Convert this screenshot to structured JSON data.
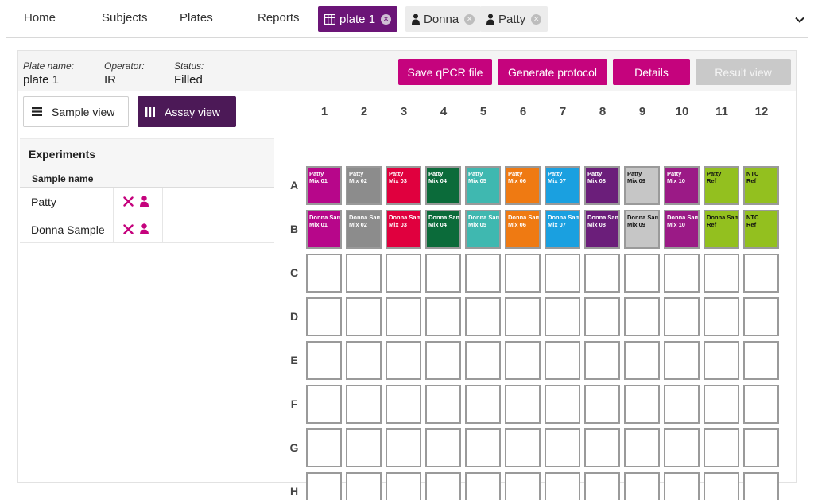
{
  "nav": {
    "links": [
      "Home",
      "Subjects",
      "Plates",
      "Reports"
    ],
    "tabs": [
      {
        "label": "plate 1",
        "icon": "grid-icon",
        "active": true
      },
      {
        "label": "Donna",
        "icon": "person-icon",
        "active": false
      },
      {
        "label": "Patty",
        "icon": "person-icon",
        "active": false
      }
    ],
    "close_glyph": "✕"
  },
  "info": {
    "plate_name_label": "Plate name:",
    "plate_name": "plate 1",
    "operator_label": "Operator:",
    "operator": "IR",
    "status_label": "Status:",
    "status": "Filled"
  },
  "actions": {
    "save_qpcr": "Save qPCR file",
    "generate_protocol": "Generate protocol",
    "details": "Details",
    "result_view": "Result view"
  },
  "views": {
    "sample_view": "Sample view",
    "assay_view": "Assay view"
  },
  "experiments": {
    "title": "Experiments",
    "column_header": "Sample name",
    "rows": [
      {
        "name": "Patty"
      },
      {
        "name": "Donna Sample"
      }
    ]
  },
  "plate": {
    "columns": [
      "1",
      "2",
      "3",
      "4",
      "5",
      "6",
      "7",
      "8",
      "9",
      "10",
      "11",
      "12"
    ],
    "rows": [
      "A",
      "B",
      "C",
      "D",
      "E",
      "F",
      "G",
      "H"
    ],
    "colors": {
      "mix01": "#b7068a",
      "mix02": "#8c8c8c",
      "mix03": "#e0003e",
      "mix04": "#0b6b3a",
      "mix05": "#3fb8b0",
      "mix06": "#ef7a12",
      "mix07": "#1aa0e0",
      "mix08": "#6b1e7a",
      "mix09": "#c6c6c6",
      "mix10": "#9b1a86",
      "ref": "#93c01f"
    },
    "wells": {
      "A": [
        {
          "l1": "Patty",
          "l2": "Mix 01",
          "c": "mix01",
          "dark": false
        },
        {
          "l1": "Patty",
          "l2": "Mix 02",
          "c": "mix02",
          "dark": false
        },
        {
          "l1": "Patty",
          "l2": "Mix 03",
          "c": "mix03",
          "dark": false
        },
        {
          "l1": "Patty",
          "l2": "Mix 04",
          "c": "mix04",
          "dark": false
        },
        {
          "l1": "Patty",
          "l2": "Mix 05",
          "c": "mix05",
          "dark": false
        },
        {
          "l1": "Patty",
          "l2": "Mix 06",
          "c": "mix06",
          "dark": false
        },
        {
          "l1": "Patty",
          "l2": "Mix 07",
          "c": "mix07",
          "dark": false
        },
        {
          "l1": "Patty",
          "l2": "Mix 08",
          "c": "mix08",
          "dark": false
        },
        {
          "l1": "Patty",
          "l2": "Mix 09",
          "c": "mix09",
          "dark": true
        },
        {
          "l1": "Patty",
          "l2": "Mix 10",
          "c": "mix10",
          "dark": false
        },
        {
          "l1": "Patty",
          "l2": "Ref",
          "c": "ref",
          "dark": true
        },
        {
          "l1": "NTC",
          "l2": "Ref",
          "c": "ref",
          "dark": true
        }
      ],
      "B": [
        {
          "l1": "Donna Sample",
          "l2": "Mix 01",
          "c": "mix01",
          "dark": false
        },
        {
          "l1": "Donna Sample",
          "l2": "Mix 02",
          "c": "mix02",
          "dark": false
        },
        {
          "l1": "Donna Sample",
          "l2": "Mix 03",
          "c": "mix03",
          "dark": false
        },
        {
          "l1": "Donna Sample",
          "l2": "Mix 04",
          "c": "mix04",
          "dark": false
        },
        {
          "l1": "Donna Sample",
          "l2": "Mix 05",
          "c": "mix05",
          "dark": false
        },
        {
          "l1": "Donna Sample",
          "l2": "Mix 06",
          "c": "mix06",
          "dark": false
        },
        {
          "l1": "Donna Sample",
          "l2": "Mix 07",
          "c": "mix07",
          "dark": false
        },
        {
          "l1": "Donna Sample",
          "l2": "Mix 08",
          "c": "mix08",
          "dark": false
        },
        {
          "l1": "Donna Sample",
          "l2": "Mix 09",
          "c": "mix09",
          "dark": true
        },
        {
          "l1": "Donna Sample",
          "l2": "Mix 10",
          "c": "mix10",
          "dark": false
        },
        {
          "l1": "Donna Sample",
          "l2": "Ref",
          "c": "ref",
          "dark": true
        },
        {
          "l1": "NTC",
          "l2": "Ref",
          "c": "ref",
          "dark": true
        }
      ]
    }
  },
  "theme": {
    "accent": "#c5037d",
    "active_tab": "#6b1577",
    "assay_view_bg": "#4c1957",
    "disabled": "#c9c9c9"
  }
}
